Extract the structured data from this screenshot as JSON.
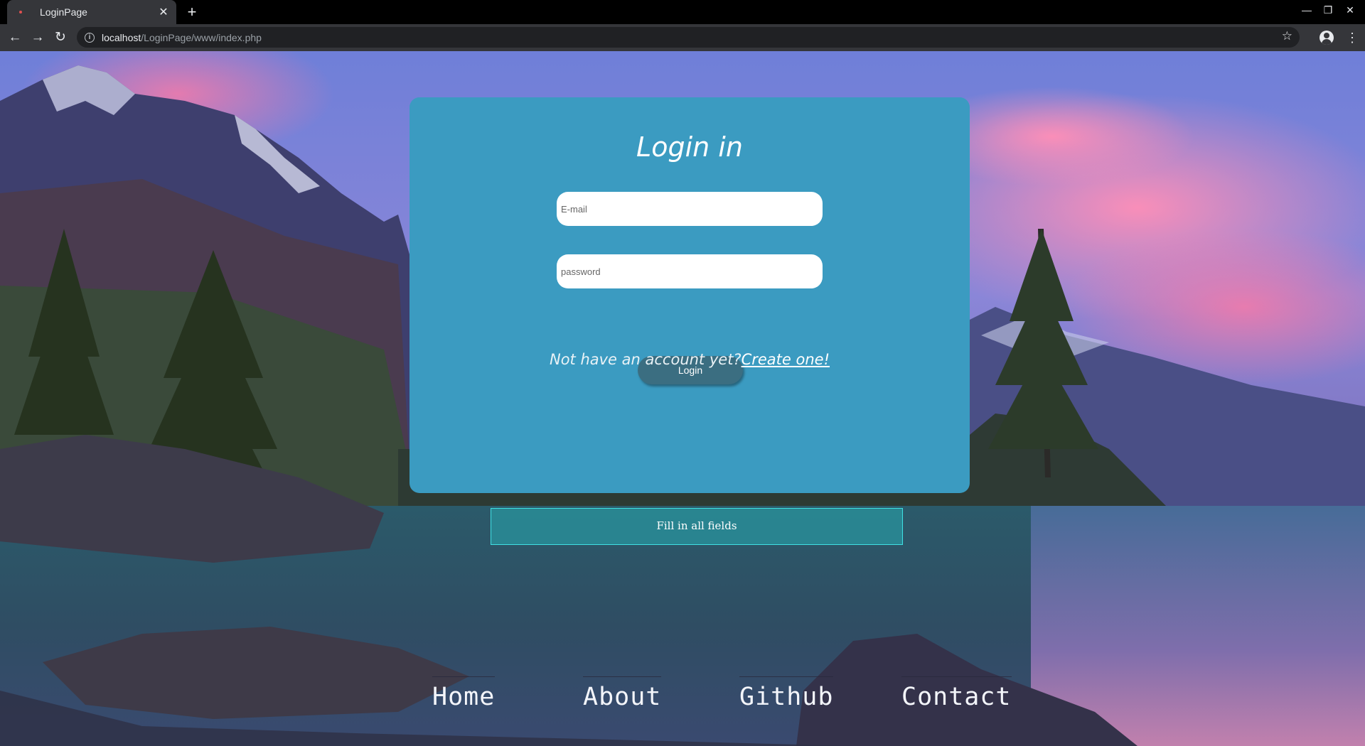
{
  "browser": {
    "tab_title": "LoginPage",
    "tab_close": "✕",
    "new_tab": "+",
    "url_host": "localhost",
    "url_path": "/LoginPage/www/index.php",
    "icons": {
      "back": "back-arrow-icon",
      "forward": "forward-arrow-icon",
      "reload": "reload-icon",
      "info": "info-icon",
      "star": "bookmark-star-icon",
      "profile": "profile-icon",
      "menu": "kebab-menu-icon",
      "minimize": "minimize-icon",
      "restore": "restore-icon",
      "close": "close-window-icon"
    }
  },
  "login": {
    "title": "Login in",
    "email_placeholder": "E-mail",
    "email_value": "",
    "password_placeholder": "password",
    "password_value": "",
    "button_label": "Login",
    "no_account_text": "Not have an account yet?",
    "create_link": "Create one!",
    "card_color": "#3b9bc1",
    "button_color": "#3b6e81"
  },
  "message": {
    "text": "Fill in all fields"
  },
  "footer_nav": [
    "Home",
    "About",
    "Github",
    "Contact"
  ]
}
